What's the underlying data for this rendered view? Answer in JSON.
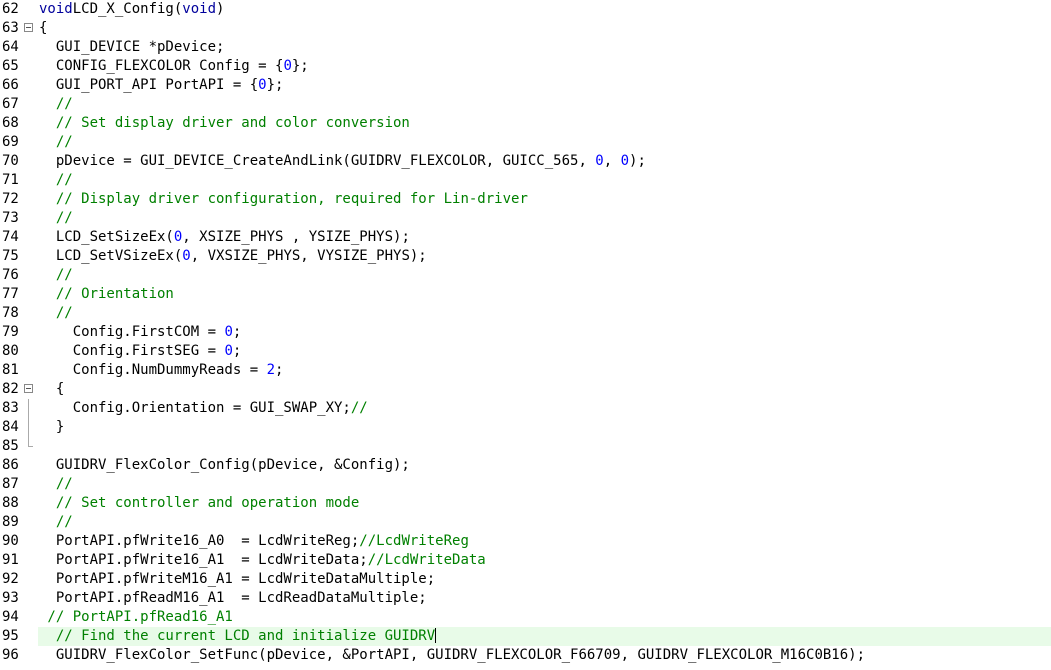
{
  "editor": {
    "colors": {
      "keyword": "#00009c",
      "comment": "#008000",
      "number": "#0000ff",
      "current_line": "#e8fbe8"
    },
    "lines": [
      {
        "n": "62",
        "segs": [
          [
            "kw",
            "void"
          ],
          [
            "",
            "LCD_X_Config("
          ],
          [
            "kw",
            "void"
          ],
          [
            "",
            ")"
          ]
        ]
      },
      {
        "n": "63",
        "fold": "open",
        "segs": [
          [
            "",
            "{"
          ]
        ]
      },
      {
        "n": "64",
        "segs": [
          [
            "",
            "  GUI_DEVICE *pDevice;"
          ]
        ]
      },
      {
        "n": "65",
        "segs": [
          [
            "",
            "  CONFIG_FLEXCOLOR Config = {"
          ],
          [
            "num",
            "0"
          ],
          [
            "",
            "};"
          ]
        ]
      },
      {
        "n": "66",
        "segs": [
          [
            "",
            "  GUI_PORT_API PortAPI = {"
          ],
          [
            "num",
            "0"
          ],
          [
            "",
            "};"
          ]
        ]
      },
      {
        "n": "67",
        "segs": [
          [
            "",
            "  "
          ],
          [
            "cm",
            "//"
          ]
        ]
      },
      {
        "n": "68",
        "segs": [
          [
            "",
            "  "
          ],
          [
            "cm",
            "// Set display driver and color conversion"
          ]
        ]
      },
      {
        "n": "69",
        "segs": [
          [
            "",
            "  "
          ],
          [
            "cm",
            "//"
          ]
        ]
      },
      {
        "n": "70",
        "segs": [
          [
            "",
            "  pDevice = GUI_DEVICE_CreateAndLink(GUIDRV_FLEXCOLOR, GUICC_565, "
          ],
          [
            "num",
            "0"
          ],
          [
            "",
            ", "
          ],
          [
            "num",
            "0"
          ],
          [
            "",
            ");"
          ]
        ]
      },
      {
        "n": "71",
        "segs": [
          [
            "",
            "  "
          ],
          [
            "cm",
            "//"
          ]
        ]
      },
      {
        "n": "72",
        "segs": [
          [
            "",
            "  "
          ],
          [
            "cm",
            "// Display driver configuration, required for Lin-driver"
          ]
        ]
      },
      {
        "n": "73",
        "segs": [
          [
            "",
            "  "
          ],
          [
            "cm",
            "//"
          ]
        ]
      },
      {
        "n": "74",
        "segs": [
          [
            "",
            "  LCD_SetSizeEx("
          ],
          [
            "num",
            "0"
          ],
          [
            "",
            ", XSIZE_PHYS , YSIZE_PHYS);"
          ]
        ]
      },
      {
        "n": "75",
        "segs": [
          [
            "",
            "  LCD_SetVSizeEx("
          ],
          [
            "num",
            "0"
          ],
          [
            "",
            ", VXSIZE_PHYS, VYSIZE_PHYS);"
          ]
        ]
      },
      {
        "n": "76",
        "segs": [
          [
            "",
            "  "
          ],
          [
            "cm",
            "//"
          ]
        ]
      },
      {
        "n": "77",
        "segs": [
          [
            "",
            "  "
          ],
          [
            "cm",
            "// Orientation"
          ]
        ]
      },
      {
        "n": "78",
        "segs": [
          [
            "",
            "  "
          ],
          [
            "cm",
            "//"
          ]
        ]
      },
      {
        "n": "79",
        "segs": [
          [
            "",
            "    Config.FirstCOM = "
          ],
          [
            "num",
            "0"
          ],
          [
            "",
            ";"
          ]
        ]
      },
      {
        "n": "80",
        "segs": [
          [
            "",
            "    Config.FirstSEG = "
          ],
          [
            "num",
            "0"
          ],
          [
            "",
            ";"
          ]
        ]
      },
      {
        "n": "81",
        "segs": [
          [
            "",
            "    Config.NumDummyReads = "
          ],
          [
            "num",
            "2"
          ],
          [
            "",
            ";"
          ]
        ]
      },
      {
        "n": "82",
        "fold": "open",
        "segs": [
          [
            "",
            "  {"
          ]
        ]
      },
      {
        "n": "83",
        "fold": "line",
        "segs": [
          [
            "",
            "    Config.Orientation = GUI_SWAP_XY;"
          ],
          [
            "cm",
            "//"
          ]
        ]
      },
      {
        "n": "84",
        "fold": "line",
        "segs": [
          [
            "",
            "  }"
          ]
        ]
      },
      {
        "n": "85",
        "fold": "end",
        "segs": [
          [
            "",
            ""
          ]
        ]
      },
      {
        "n": "86",
        "segs": [
          [
            "",
            "  GUIDRV_FlexColor_Config(pDevice, &Config);"
          ]
        ]
      },
      {
        "n": "87",
        "segs": [
          [
            "",
            "  "
          ],
          [
            "cm",
            "//"
          ]
        ]
      },
      {
        "n": "88",
        "segs": [
          [
            "",
            "  "
          ],
          [
            "cm",
            "// Set controller and operation mode"
          ]
        ]
      },
      {
        "n": "89",
        "segs": [
          [
            "",
            "  "
          ],
          [
            "cm",
            "//"
          ]
        ]
      },
      {
        "n": "90",
        "segs": [
          [
            "",
            "  PortAPI.pfWrite16_A0  = LcdWriteReg;"
          ],
          [
            "cm",
            "//LcdWriteReg"
          ]
        ]
      },
      {
        "n": "91",
        "segs": [
          [
            "",
            "  PortAPI.pfWrite16_A1  = LcdWriteData;"
          ],
          [
            "cm",
            "//LcdWriteData"
          ]
        ]
      },
      {
        "n": "92",
        "segs": [
          [
            "",
            "  PortAPI.pfWriteM16_A1 = LcdWriteDataMultiple;"
          ]
        ]
      },
      {
        "n": "93",
        "segs": [
          [
            "",
            "  PortAPI.pfReadM16_A1  = LcdReadDataMultiple;"
          ]
        ]
      },
      {
        "n": "94",
        "segs": [
          [
            "cm",
            " // PortAPI.pfRead16_A1"
          ]
        ]
      },
      {
        "n": "95",
        "current": true,
        "segs": [
          [
            "",
            "  "
          ],
          [
            "cm",
            "// Find the current LCD and initialize GUIDRV"
          ]
        ]
      },
      {
        "n": "96",
        "segs": [
          [
            "",
            "  GUIDRV_FlexColor_SetFunc(pDevice, &PortAPI, GUIDRV_FLEXCOLOR_F66709, GUIDRV_FLEXCOLOR_M16C0B16);"
          ]
        ]
      }
    ]
  }
}
